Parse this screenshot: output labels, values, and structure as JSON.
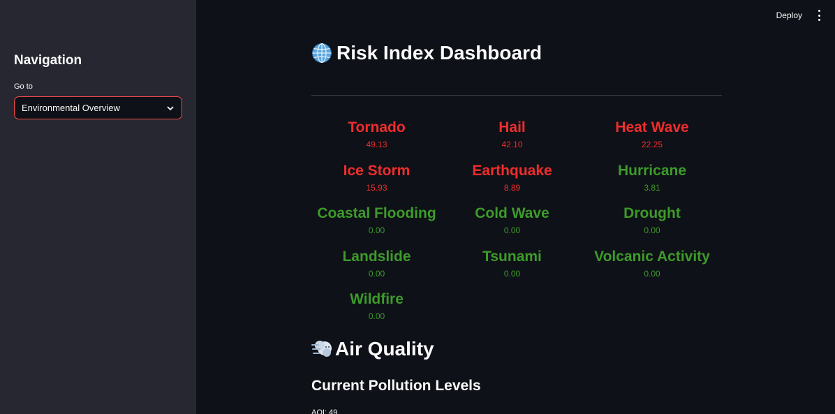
{
  "sidebar": {
    "title": "Navigation",
    "goto_label": "Go to",
    "select_value": "Environmental Overview"
  },
  "topbar": {
    "deploy_label": "Deploy"
  },
  "main": {
    "title": "Risk Index Dashboard",
    "title_icon": "globe-icon",
    "risks": [
      {
        "name": "Tornado",
        "value": "49.13",
        "status": "red"
      },
      {
        "name": "Hail",
        "value": "42.10",
        "status": "red"
      },
      {
        "name": "Heat Wave",
        "value": "22.25",
        "status": "red"
      },
      {
        "name": "Ice Storm",
        "value": "15.93",
        "status": "red"
      },
      {
        "name": "Earthquake",
        "value": "8.89",
        "status": "red"
      },
      {
        "name": "Hurricane",
        "value": "3.81",
        "status": "green"
      },
      {
        "name": "Coastal Flooding",
        "value": "0.00",
        "status": "green"
      },
      {
        "name": "Cold Wave",
        "value": "0.00",
        "status": "green"
      },
      {
        "name": "Drought",
        "value": "0.00",
        "status": "green"
      },
      {
        "name": "Landslide",
        "value": "0.00",
        "status": "green"
      },
      {
        "name": "Tsunami",
        "value": "0.00",
        "status": "green"
      },
      {
        "name": "Volcanic Activity",
        "value": "0.00",
        "status": "green"
      },
      {
        "name": "Wildfire",
        "value": "0.00",
        "status": "green"
      }
    ],
    "air_quality_title": "Air Quality",
    "air_quality_icon": "wind-face-icon",
    "pollution_subtitle": "Current Pollution Levels",
    "aqi_text": "AQI: 49"
  },
  "colors": {
    "red": "#ef2d2d",
    "green": "#3d9b2a",
    "accent": "#ff4b4b",
    "sidebar_bg": "#262730",
    "main_bg": "#0e1117"
  }
}
